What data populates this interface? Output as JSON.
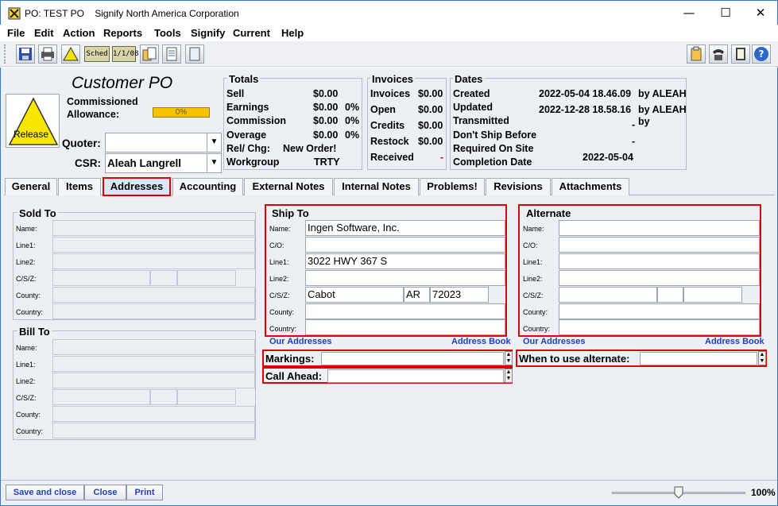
{
  "window": {
    "title": "PO: TEST PO    Signify North America Corporation",
    "minimize": "—",
    "maximize": "☐",
    "close": "✕"
  },
  "menu": [
    "File",
    "Edit",
    "Action",
    "Reports",
    "Tools",
    "Signify",
    "Current",
    "Help"
  ],
  "toolbar": {
    "sched_label": "Sched",
    "date_label": "1/1/08"
  },
  "header": {
    "doc_type": "Customer PO",
    "commissioned_allowance_label_1": "Commissioned",
    "commissioned_allowance_label_2": "Allowance:",
    "allowance_value": "0%",
    "release_label": "Release",
    "quoter_label": "Quoter:",
    "quoter_value": "",
    "csr_label": "CSR:",
    "csr_value": "Aleah Langrell"
  },
  "totals": {
    "title": "Totals",
    "rows": [
      {
        "label": "Sell",
        "value": "$0.00",
        "pct": ""
      },
      {
        "label": "Earnings",
        "value": "$0.00",
        "pct": "0%"
      },
      {
        "label": "Commission",
        "value": "$0.00",
        "pct": "0%"
      },
      {
        "label": "Overage",
        "value": "$0.00",
        "pct": "0%"
      },
      {
        "label": "Rel/ Chg:",
        "value": "New Order!",
        "pct": ""
      },
      {
        "label": "Workgroup",
        "value": "TRTY",
        "pct": ""
      }
    ]
  },
  "invoices": {
    "title": "Invoices",
    "rows": [
      {
        "label": "Invoices",
        "value": "$0.00"
      },
      {
        "label": "Open",
        "value": "$0.00"
      },
      {
        "label": "Credits",
        "value": "$0.00"
      },
      {
        "label": "Restock",
        "value": "$0.00"
      },
      {
        "label": "Received",
        "value": "-"
      }
    ]
  },
  "dates": {
    "title": "Dates",
    "rows": [
      {
        "label": "Created",
        "value": "2022-05-04 18.46.09",
        "by": "by ALEAH"
      },
      {
        "label": "Updated",
        "value": "2022-12-28 18.58.16",
        "by": "by ALEAH"
      },
      {
        "label": "Transmitted",
        "value": "-",
        "by": "by"
      },
      {
        "label": "Don't Ship Before",
        "value": "-",
        "by": ""
      },
      {
        "label": "Required On Site",
        "value": "-",
        "by": ""
      },
      {
        "label": "Completion Date",
        "value": "2022-05-04",
        "by": ""
      }
    ]
  },
  "tabs": [
    "General",
    "Items",
    "Addresses",
    "Accounting",
    "External Notes",
    "Internal Notes",
    "Problems!",
    "Revisions",
    "Attachments"
  ],
  "address_labels": {
    "name": "Name:",
    "co": "C/O:",
    "line1": "Line1:",
    "line2": "Line2:",
    "csz": "C/S/Z:",
    "county": "County:",
    "country": "Country:"
  },
  "sold_to": {
    "title": "Sold To"
  },
  "bill_to": {
    "title": "Bill To"
  },
  "ship_to": {
    "title": "Ship To",
    "name": "Ingen Software, Inc.",
    "co": "",
    "line1": "3022 HWY 367 S",
    "line2": "",
    "city": "Cabot",
    "state": "AR",
    "zip": "72023",
    "county": "",
    "country": ""
  },
  "alternate": {
    "title": "Alternate"
  },
  "links": {
    "our_addresses": "Our Addresses",
    "address_book": "Address Book"
  },
  "markings_label": "Markings:",
  "call_ahead_label": "Call Ahead:",
  "when_alternate_label": "When to use alternate:",
  "buttons": {
    "save_close": "Save and close",
    "close": "Close",
    "print": "Print"
  },
  "zoom": {
    "value": "100%",
    "level": 0.5
  },
  "colors": {
    "highlight_red": "#e00000",
    "allowance_bar": "#f5c400",
    "link_blue": "#1f3fbf"
  }
}
